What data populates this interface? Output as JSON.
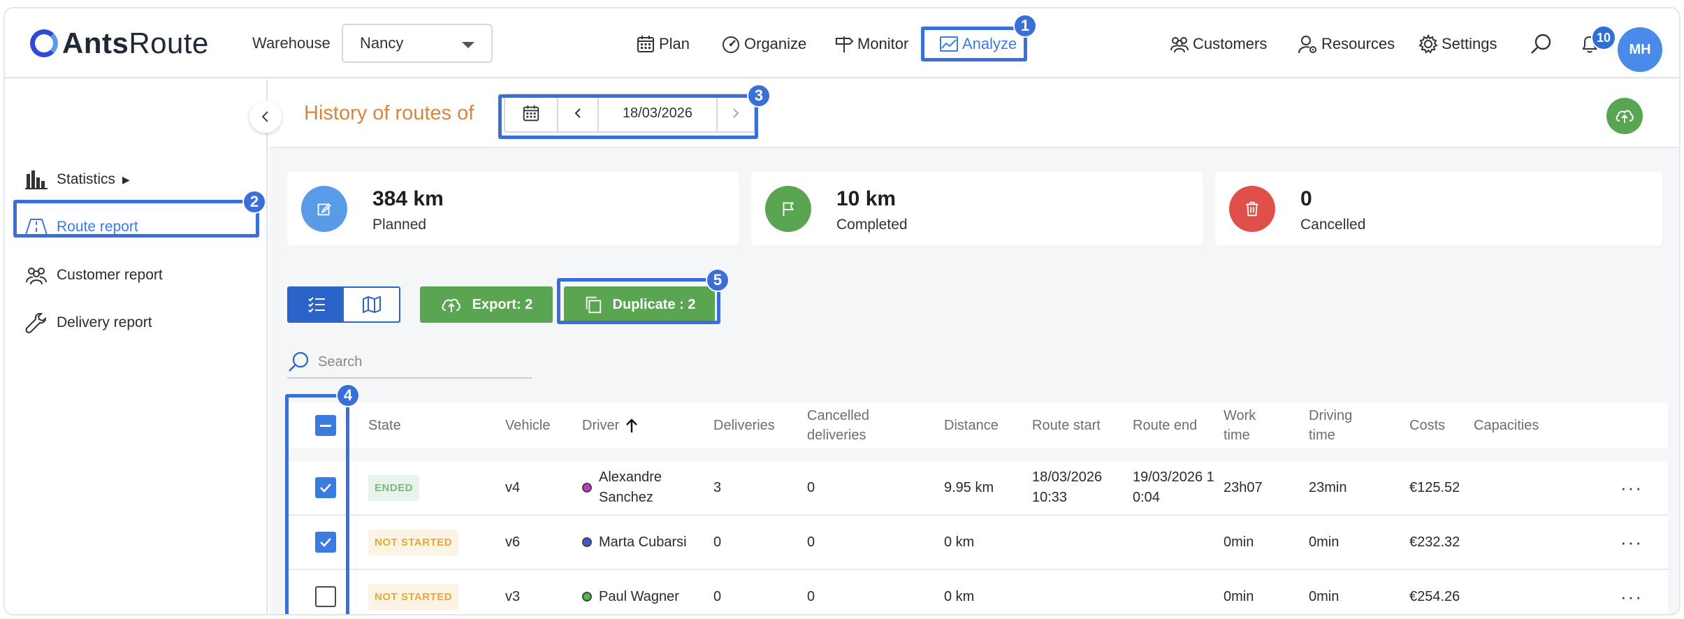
{
  "app": {
    "logo_bold": "Ants",
    "logo_light": "Route"
  },
  "header": {
    "warehouse_label": "Warehouse",
    "warehouse_value": "Nancy",
    "nav": [
      {
        "label": "Plan",
        "icon": "calendar-icon"
      },
      {
        "label": "Organize",
        "icon": "gauge-icon"
      },
      {
        "label": "Monitor",
        "icon": "signpost-icon"
      },
      {
        "label": "Analyze",
        "icon": "chart-icon",
        "active": true
      }
    ],
    "right_nav": [
      {
        "label": "Customers",
        "icon": "users-icon"
      },
      {
        "label": "Resources",
        "icon": "user-gear-icon"
      },
      {
        "label": "Settings",
        "icon": "gear-icon"
      }
    ],
    "notifications_count": "10",
    "avatar_initials": "MH"
  },
  "sidebar": {
    "items": [
      {
        "label": "Statistics",
        "icon": "bar-chart-icon",
        "has_submenu": true
      },
      {
        "label": "Route report",
        "icon": "road-icon",
        "active": true
      },
      {
        "label": "Customer report",
        "icon": "users-icon"
      },
      {
        "label": "Delivery report",
        "icon": "wrench-icon"
      }
    ],
    "submenu_arrow": "▶"
  },
  "subheader": {
    "title": "History of routes of",
    "date": "18/03/2026"
  },
  "stats": [
    {
      "value": "384 km",
      "label": "Planned",
      "color": "#5a9be8",
      "icon": "edit-icon"
    },
    {
      "value": "10 km",
      "label": "Completed",
      "color": "#5aa551",
      "icon": "flag-icon"
    },
    {
      "value": "0",
      "label": "Cancelled",
      "color": "#e0504a",
      "icon": "trash-icon"
    }
  ],
  "toolbar": {
    "export_label": "Export: 2",
    "duplicate_label": "Duplicate : 2"
  },
  "search": {
    "placeholder": "Search"
  },
  "table": {
    "columns": {
      "state": "State",
      "vehicle": "Vehicle",
      "driver": "Driver",
      "deliveries": "Deliveries",
      "cancelled_1": "Cancelled",
      "cancelled_2": "deliveries",
      "distance": "Distance",
      "route_start": "Route start",
      "route_end": "Route end",
      "work_1": "Work",
      "work_2": "time",
      "driving_1": "Driving",
      "driving_2": "time",
      "costs": "Costs",
      "capacities": "Capacities"
    },
    "rows": [
      {
        "checked": true,
        "state": "ENDED",
        "vehicle": "v4",
        "driver_1": "Alexandre",
        "driver_2": "Sanchez",
        "dot": "#c837c8",
        "deliveries": "3",
        "cancelled": "0",
        "distance": "9.95 km",
        "start_1": "18/03/2026",
        "start_2": "10:33",
        "end_1": "19/03/2026 1",
        "end_2": "0:04",
        "work": "23h07",
        "driving": "23min",
        "costs": "€125.52"
      },
      {
        "checked": true,
        "state": "NOT STARTED",
        "vehicle": "v6",
        "driver_1": "Marta Cubarsi",
        "driver_2": "",
        "dot": "#3a5ad8",
        "deliveries": "0",
        "cancelled": "0",
        "distance": "0 km",
        "start_1": "",
        "start_2": "",
        "end_1": "",
        "end_2": "",
        "work": "0min",
        "driving": "0min",
        "costs": "€232.32"
      },
      {
        "checked": false,
        "state": "NOT STARTED",
        "vehicle": "v3",
        "driver_1": "Paul Wagner",
        "driver_2": "",
        "dot": "#4cbb4c",
        "deliveries": "0",
        "cancelled": "0",
        "distance": "0 km",
        "start_1": "",
        "start_2": "",
        "end_1": "",
        "end_2": "",
        "work": "0min",
        "driving": "0min",
        "costs": "€254.26"
      }
    ],
    "row_menu": "···"
  },
  "callouts": [
    "1",
    "2",
    "3",
    "4",
    "5"
  ]
}
